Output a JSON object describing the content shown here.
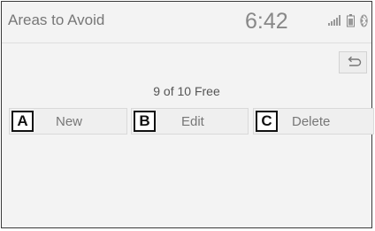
{
  "header": {
    "title": "Areas to Avoid",
    "time": "6:42",
    "icons": [
      "signal-icon",
      "battery-icon",
      "bluetooth-icon"
    ]
  },
  "toolbar": {
    "back_icon": "back-arrow-icon"
  },
  "main": {
    "free_count": "9 of 10 Free",
    "actions": [
      {
        "marker": "A",
        "label": "New"
      },
      {
        "marker": "B",
        "label": "Edit"
      },
      {
        "marker": "C",
        "label": "Delete"
      }
    ]
  },
  "colors": {
    "background": "#f3f3f3",
    "button": "#efefef",
    "text_gray": "#777777"
  }
}
